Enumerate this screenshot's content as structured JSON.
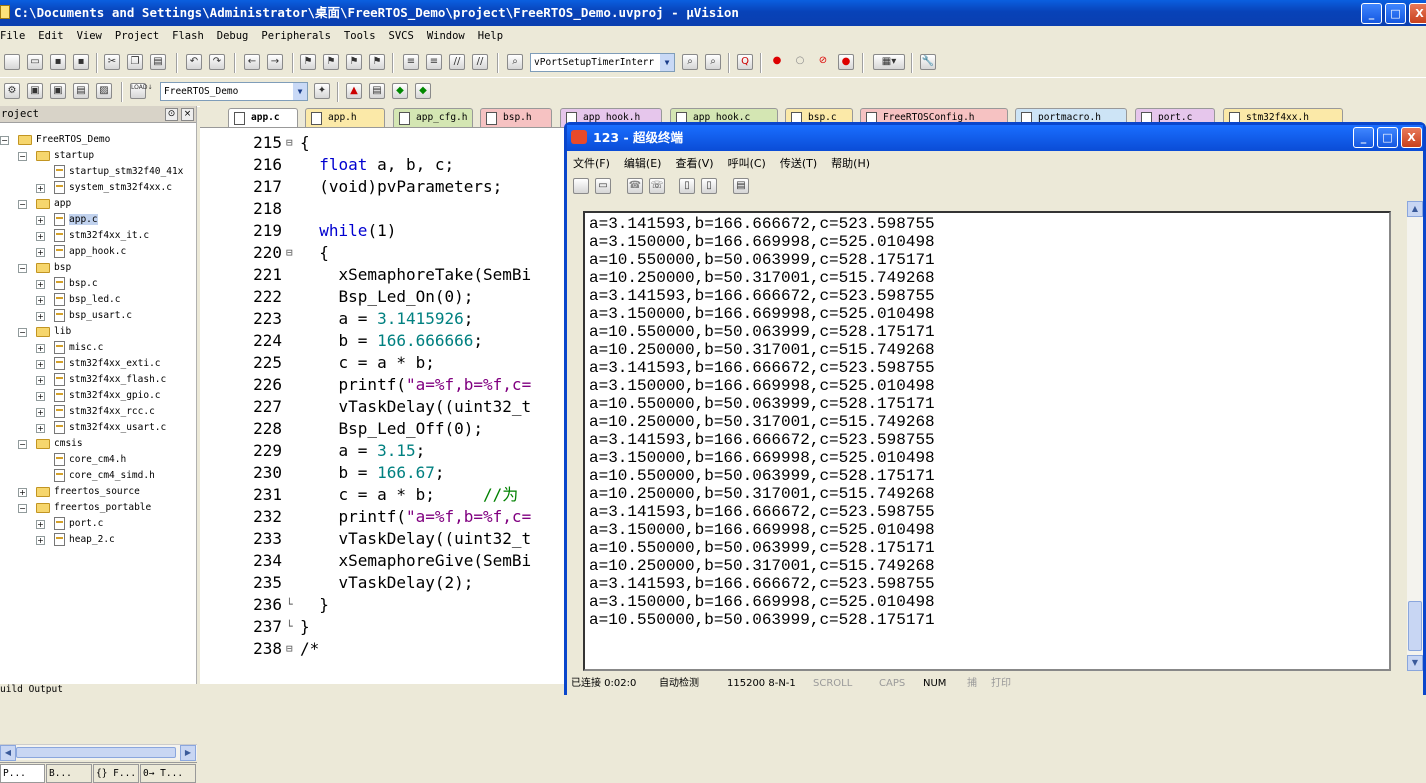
{
  "app": {
    "title": "C:\\Documents and Settings\\Administrator\\桌面\\FreeRTOS_Demo\\project\\FreeRTOS_Demo.uvproj - µVision",
    "controls": {
      "min": "_",
      "max": "□",
      "close": "X"
    }
  },
  "menu": [
    "File",
    "Edit",
    "View",
    "Project",
    "Flash",
    "Debug",
    "Peripherals",
    "Tools",
    "SVCS",
    "Window",
    "Help"
  ],
  "toolbar1": {
    "function_combo": "vPortSetupTimerInterr"
  },
  "toolbar2": {
    "target_combo": "FreeRTOS_Demo",
    "load_label": "LOAD"
  },
  "project": {
    "header": "roject",
    "tree": [
      {
        "label": "FreeRTOS_Demo",
        "type": "root",
        "level": 0,
        "box": "−"
      },
      {
        "label": "startup",
        "type": "folder",
        "level": 1,
        "box": "−"
      },
      {
        "label": "startup_stm32f40_41x",
        "type": "file",
        "level": 2,
        "box": ""
      },
      {
        "label": "system_stm32f4xx.c",
        "type": "file",
        "level": 2,
        "box": "+"
      },
      {
        "label": "app",
        "type": "folder",
        "level": 1,
        "box": "−"
      },
      {
        "label": "app.c",
        "type": "file",
        "level": 2,
        "box": "+",
        "selected": true
      },
      {
        "label": "stm32f4xx_it.c",
        "type": "file",
        "level": 2,
        "box": "+"
      },
      {
        "label": "app_hook.c",
        "type": "file",
        "level": 2,
        "box": "+"
      },
      {
        "label": "bsp",
        "type": "folder",
        "level": 1,
        "box": "−"
      },
      {
        "label": "bsp.c",
        "type": "file",
        "level": 2,
        "box": "+"
      },
      {
        "label": "bsp_led.c",
        "type": "file",
        "level": 2,
        "box": "+"
      },
      {
        "label": "bsp_usart.c",
        "type": "file",
        "level": 2,
        "box": "+"
      },
      {
        "label": "lib",
        "type": "folder",
        "level": 1,
        "box": "−"
      },
      {
        "label": "misc.c",
        "type": "file",
        "level": 2,
        "box": "+"
      },
      {
        "label": "stm32f4xx_exti.c",
        "type": "file",
        "level": 2,
        "box": "+"
      },
      {
        "label": "stm32f4xx_flash.c",
        "type": "file",
        "level": 2,
        "box": "+"
      },
      {
        "label": "stm32f4xx_gpio.c",
        "type": "file",
        "level": 2,
        "box": "+"
      },
      {
        "label": "stm32f4xx_rcc.c",
        "type": "file",
        "level": 2,
        "box": "+"
      },
      {
        "label": "stm32f4xx_usart.c",
        "type": "file",
        "level": 2,
        "box": "+"
      },
      {
        "label": "cmsis",
        "type": "folder",
        "level": 1,
        "box": "−"
      },
      {
        "label": "core_cm4.h",
        "type": "file",
        "level": 2,
        "box": ""
      },
      {
        "label": "core_cm4_simd.h",
        "type": "file",
        "level": 2,
        "box": ""
      },
      {
        "label": "freertos_source",
        "type": "folder",
        "level": 1,
        "box": "+"
      },
      {
        "label": "freertos_portable",
        "type": "folder",
        "level": 1,
        "box": "−"
      },
      {
        "label": "port.c",
        "type": "file",
        "level": 2,
        "box": "+"
      },
      {
        "label": "heap_2.c",
        "type": "file",
        "level": 2,
        "box": "+"
      }
    ],
    "tabs": [
      "P...",
      "B...",
      "{} F...",
      "0→ T..."
    ]
  },
  "build_label": "uild Output",
  "editor": {
    "tabs": [
      {
        "label": "app.c",
        "color": "#ffffff",
        "active": true
      },
      {
        "label": "app.h",
        "color": "#fbe9a8"
      },
      {
        "label": "app_cfg.h",
        "color": "#d4e6b3"
      },
      {
        "label": "bsp.h",
        "color": "#f6c2c2"
      },
      {
        "label": "app_hook.h",
        "color": "#e6c6ec"
      },
      {
        "label": "app_hook.c",
        "color": "#d4e6b3"
      },
      {
        "label": "bsp.c",
        "color": "#fbe9a8"
      },
      {
        "label": "FreeRTOSConfig.h",
        "color": "#f6c2c2"
      },
      {
        "label": "portmacro.h",
        "color": "#cde4f6"
      },
      {
        "label": "port.c",
        "color": "#e6c6ec"
      },
      {
        "label": "stm32f4xx.h",
        "color": "#fbe9a8"
      }
    ],
    "line_numbers": [
      "215",
      "216",
      "217",
      "218",
      "219",
      "220",
      "221",
      "222",
      "223",
      "224",
      "225",
      "226",
      "227",
      "228",
      "229",
      "230",
      "231",
      "232",
      "233",
      "234",
      "235",
      "236",
      "237",
      "238"
    ],
    "folds": [
      "⊟",
      "",
      "",
      "",
      "",
      "⊟",
      "",
      "",
      "",
      "",
      "",
      "",
      "",
      "",
      "",
      "",
      "",
      "",
      "",
      "",
      "",
      "└",
      "└",
      "⊟"
    ],
    "lines": [
      [
        {
          "t": "{"
        }
      ],
      [
        {
          "t": "  "
        },
        {
          "t": "float",
          "c": "kw"
        },
        {
          "t": " a, b, c;"
        }
      ],
      [
        {
          "t": "  (void)pvParameters;"
        }
      ],
      [
        {
          "t": ""
        }
      ],
      [
        {
          "t": "  "
        },
        {
          "t": "while",
          "c": "kw"
        },
        {
          "t": "(1)"
        }
      ],
      [
        {
          "t": "  {"
        }
      ],
      [
        {
          "t": "    xSemaphoreTake(SemBi"
        }
      ],
      [
        {
          "t": "    Bsp_Led_On(0);"
        }
      ],
      [
        {
          "t": "    a = "
        },
        {
          "t": "3.1415926",
          "c": "num"
        },
        {
          "t": ";"
        }
      ],
      [
        {
          "t": "    b = "
        },
        {
          "t": "166.666666",
          "c": "num"
        },
        {
          "t": ";"
        }
      ],
      [
        {
          "t": "    c = a * b;"
        }
      ],
      [
        {
          "t": "    printf("
        },
        {
          "t": "\"a=%f,b=%f,c=",
          "c": "str"
        }
      ],
      [
        {
          "t": "    vTaskDelay((uint32_t"
        }
      ],
      [
        {
          "t": "    Bsp_Led_Off(0);"
        }
      ],
      [
        {
          "t": "    a = "
        },
        {
          "t": "3.15",
          "c": "num"
        },
        {
          "t": ";"
        }
      ],
      [
        {
          "t": "    b = "
        },
        {
          "t": "166.67",
          "c": "num"
        },
        {
          "t": ";"
        }
      ],
      [
        {
          "t": "    c = a * b;     "
        },
        {
          "t": "//为",
          "c": "cmt"
        }
      ],
      [
        {
          "t": "    printf("
        },
        {
          "t": "\"a=%f,b=%f,c=",
          "c": "str"
        }
      ],
      [
        {
          "t": "    vTaskDelay((uint32_t"
        }
      ],
      [
        {
          "t": "    xSemaphoreGive(SemBi"
        }
      ],
      [
        {
          "t": "    vTaskDelay(2);"
        }
      ],
      [
        {
          "t": "  }"
        }
      ],
      [
        {
          "t": "}"
        }
      ],
      [
        {
          "t": "/*"
        }
      ]
    ]
  },
  "terminal": {
    "title": "123 - 超级终端",
    "menu": [
      "文件(F)",
      "编辑(E)",
      "查看(V)",
      "呼叫(C)",
      "传送(T)",
      "帮助(H)"
    ],
    "lines": [
      "a=3.141593,b=166.666672,c=523.598755",
      "a=3.150000,b=166.669998,c=525.010498",
      "a=10.550000,b=50.063999,c=528.175171",
      "a=10.250000,b=50.317001,c=515.749268",
      "a=3.141593,b=166.666672,c=523.598755",
      "a=3.150000,b=166.669998,c=525.010498",
      "a=10.550000,b=50.063999,c=528.175171",
      "a=10.250000,b=50.317001,c=515.749268",
      "a=3.141593,b=166.666672,c=523.598755",
      "a=3.150000,b=166.669998,c=525.010498",
      "a=10.550000,b=50.063999,c=528.175171",
      "a=10.250000,b=50.317001,c=515.749268",
      "a=3.141593,b=166.666672,c=523.598755",
      "a=3.150000,b=166.669998,c=525.010498",
      "a=10.550000,b=50.063999,c=528.175171",
      "a=10.250000,b=50.317001,c=515.749268",
      "a=3.141593,b=166.666672,c=523.598755",
      "a=3.150000,b=166.669998,c=525.010498",
      "a=10.550000,b=50.063999,c=528.175171",
      "a=10.250000,b=50.317001,c=515.749268",
      "a=3.141593,b=166.666672,c=523.598755",
      "a=3.150000,b=166.669998,c=525.010498",
      "a=10.550000,b=50.063999,c=528.175171"
    ],
    "status": {
      "connected": "已连接 0:02:0",
      "detect": "自动检测",
      "port": "115200 8-N-1",
      "scroll": "SCROLL",
      "caps": "CAPS",
      "num": "NUM",
      "capture": "捕",
      "print": "打印"
    }
  }
}
